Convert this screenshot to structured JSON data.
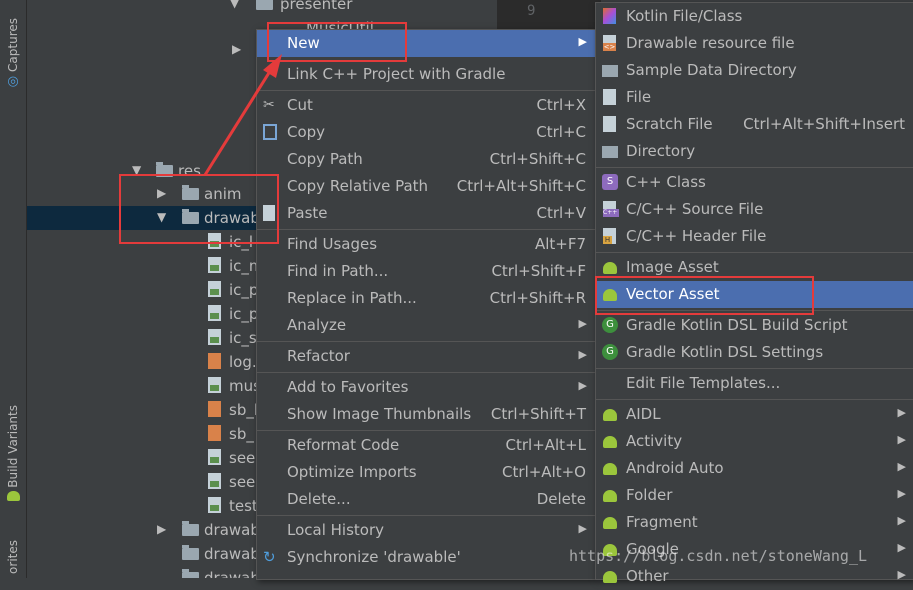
{
  "sidebar": {
    "captures_label": "Captures",
    "build_variants_label": "Build Variants",
    "favorites_label": "orites"
  },
  "editor": {
    "line_number": "9"
  },
  "tree": {
    "rows": [
      {
        "label": "presenter",
        "arrow": "▼"
      },
      {
        "label": "MusicUtil"
      },
      {
        "label": "",
        "arrow": "▶"
      },
      {
        "label": "res",
        "arrow": "▼"
      },
      {
        "label": "anim",
        "arrow": "▶"
      },
      {
        "label": "drawab",
        "arrow": "▼"
      },
      {
        "label": "ic_l"
      },
      {
        "label": "ic_m"
      },
      {
        "label": "ic_p"
      },
      {
        "label": "ic_p"
      },
      {
        "label": "ic_s"
      },
      {
        "label": "log."
      },
      {
        "label": "mus"
      },
      {
        "label": "sb_l"
      },
      {
        "label": "sb_"
      },
      {
        "label": "see"
      },
      {
        "label": "see"
      },
      {
        "label": "test"
      },
      {
        "label": "drawab",
        "arrow": "▶"
      },
      {
        "label": "drawab"
      },
      {
        "label": "drawab"
      }
    ]
  },
  "context_menu": {
    "items": [
      {
        "label": "New",
        "shortcut": "",
        "submenu": true
      },
      {
        "label": "Link C++ Project with Gradle",
        "shortcut": ""
      },
      {
        "label": "Cut",
        "shortcut": "Ctrl+X"
      },
      {
        "label": "Copy",
        "shortcut": "Ctrl+C"
      },
      {
        "label": "Copy Path",
        "shortcut": "Ctrl+Shift+C"
      },
      {
        "label": "Copy Relative Path",
        "shortcut": "Ctrl+Alt+Shift+C"
      },
      {
        "label": "Paste",
        "shortcut": "Ctrl+V"
      },
      {
        "label": "Find Usages",
        "shortcut": "Alt+F7"
      },
      {
        "label": "Find in Path...",
        "shortcut": "Ctrl+Shift+F"
      },
      {
        "label": "Replace in Path...",
        "shortcut": "Ctrl+Shift+R"
      },
      {
        "label": "Analyze",
        "shortcut": "",
        "submenu": true
      },
      {
        "label": "Refactor",
        "shortcut": "",
        "submenu": true
      },
      {
        "label": "Add to Favorites",
        "shortcut": "",
        "submenu": true
      },
      {
        "label": "Show Image Thumbnails",
        "shortcut": "Ctrl+Shift+T"
      },
      {
        "label": "Reformat Code",
        "shortcut": "Ctrl+Alt+L"
      },
      {
        "label": "Optimize Imports",
        "shortcut": "Ctrl+Alt+O"
      },
      {
        "label": "Delete...",
        "shortcut": "Delete"
      },
      {
        "label": "Local History",
        "shortcut": "",
        "submenu": true
      },
      {
        "label": "Synchronize 'drawable'",
        "shortcut": ""
      }
    ]
  },
  "new_submenu": {
    "items": [
      {
        "label": "Kotlin File/Class",
        "shortcut": ""
      },
      {
        "label": "Drawable resource file",
        "shortcut": ""
      },
      {
        "label": "Sample Data Directory",
        "shortcut": ""
      },
      {
        "label": "File",
        "shortcut": ""
      },
      {
        "label": "Scratch File",
        "shortcut": "Ctrl+Alt+Shift+Insert"
      },
      {
        "label": "Directory",
        "shortcut": ""
      },
      {
        "label": "C++ Class",
        "shortcut": ""
      },
      {
        "label": "C/C++ Source File",
        "shortcut": ""
      },
      {
        "label": "C/C++ Header File",
        "shortcut": ""
      },
      {
        "label": "Image Asset",
        "shortcut": ""
      },
      {
        "label": "Vector Asset",
        "shortcut": ""
      },
      {
        "label": "Gradle Kotlin DSL Build Script",
        "shortcut": ""
      },
      {
        "label": "Gradle Kotlin DSL Settings",
        "shortcut": ""
      },
      {
        "label": "Edit File Templates...",
        "shortcut": ""
      },
      {
        "label": "AIDL",
        "shortcut": "",
        "submenu": true
      },
      {
        "label": "Activity",
        "shortcut": "",
        "submenu": true
      },
      {
        "label": "Android Auto",
        "shortcut": "",
        "submenu": true
      },
      {
        "label": "Folder",
        "shortcut": "",
        "submenu": true
      },
      {
        "label": "Fragment",
        "shortcut": "",
        "submenu": true
      },
      {
        "label": "Google",
        "shortcut": "",
        "submenu": true
      },
      {
        "label": "Other",
        "shortcut": "",
        "submenu": true
      }
    ]
  },
  "watermark": "https://blog.csdn.net/stoneWang_L",
  "colors": {
    "highlight": "#4b6eaf",
    "annotation": "#e43b3b",
    "background": "#3c3f41"
  }
}
